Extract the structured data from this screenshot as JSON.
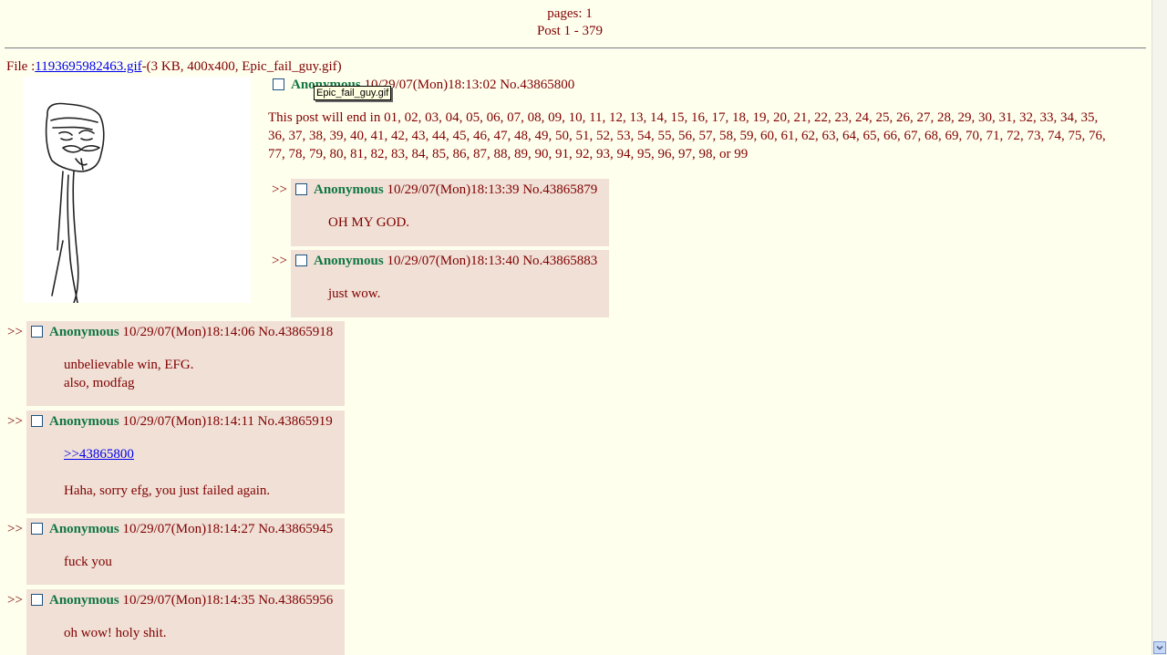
{
  "header": {
    "pages": "pages: 1",
    "posts": "Post 1 - 379"
  },
  "op": {
    "file_prefix": "File :",
    "file_link": "1193695982463.gif",
    "file_info": "-(3 KB, 400x400, Epic_fail_guy.gif)",
    "name": "Anonymous",
    "datetime": "10/29/07(Mon)18:13:02",
    "no": "No.43865800",
    "text": "This post will end in 01, 02, 03, 04, 05, 06, 07, 08, 09, 10, 11, 12, 13, 14, 15, 16, 17, 18, 19, 20, 21, 22, 23, 24, 25, 26, 27, 28, 29, 30, 31, 32, 33, 34, 35, 36, 37, 38, 39, 40, 41, 42, 43, 44, 45, 46, 47, 48, 49, 50, 51, 52, 53, 54, 55, 56, 57, 58, 59, 60, 61, 62, 63, 64, 65, 66, 67, 68, 69, 70, 71, 72, 73, 74, 75, 76, 77, 78, 79, 80, 81, 82, 83, 84, 85, 86, 87, 88, 89, 90, 91, 92, 93, 94, 95, 96, 97, 98, or 99"
  },
  "tooltip": "Epic_fail_guy.gif",
  "replies": [
    {
      "arrows": ">>",
      "name": "Anonymous",
      "datetime": "10/29/07(Mon)18:13:39",
      "no": "No.43865879",
      "line1": "OH MY GOD."
    },
    {
      "arrows": ">>",
      "name": "Anonymous",
      "datetime": "10/29/07(Mon)18:13:40",
      "no": "No.43865883",
      "line1": "just wow."
    },
    {
      "arrows": ">>",
      "name": "Anonymous",
      "datetime": "10/29/07(Mon)18:14:06",
      "no": "No.43865918",
      "line1": "unbelievable win, EFG.",
      "line2": "also, modfag"
    },
    {
      "arrows": ">>",
      "name": "Anonymous",
      "datetime": "10/29/07(Mon)18:14:11",
      "no": "No.43865919",
      "quote": ">>43865800",
      "line1": "Haha, sorry efg, you just failed again."
    },
    {
      "arrows": ">>",
      "name": "Anonymous",
      "datetime": "10/29/07(Mon)18:14:27",
      "no": "No.43865945",
      "line1": "fuck you"
    },
    {
      "arrows": ">>",
      "name": "Anonymous",
      "datetime": "10/29/07(Mon)18:14:35",
      "no": "No.43865956",
      "line1": "oh wow! holy shit."
    }
  ],
  "icons": {
    "scroll_down": "chevron-down-icon",
    "thumbnail": "epic-fail-guy-drawing"
  },
  "colors": {
    "background": "#ffffee",
    "text": "#800000",
    "name": "#117743",
    "reply_bg": "#f0e0d6",
    "link": "#0000ee"
  }
}
